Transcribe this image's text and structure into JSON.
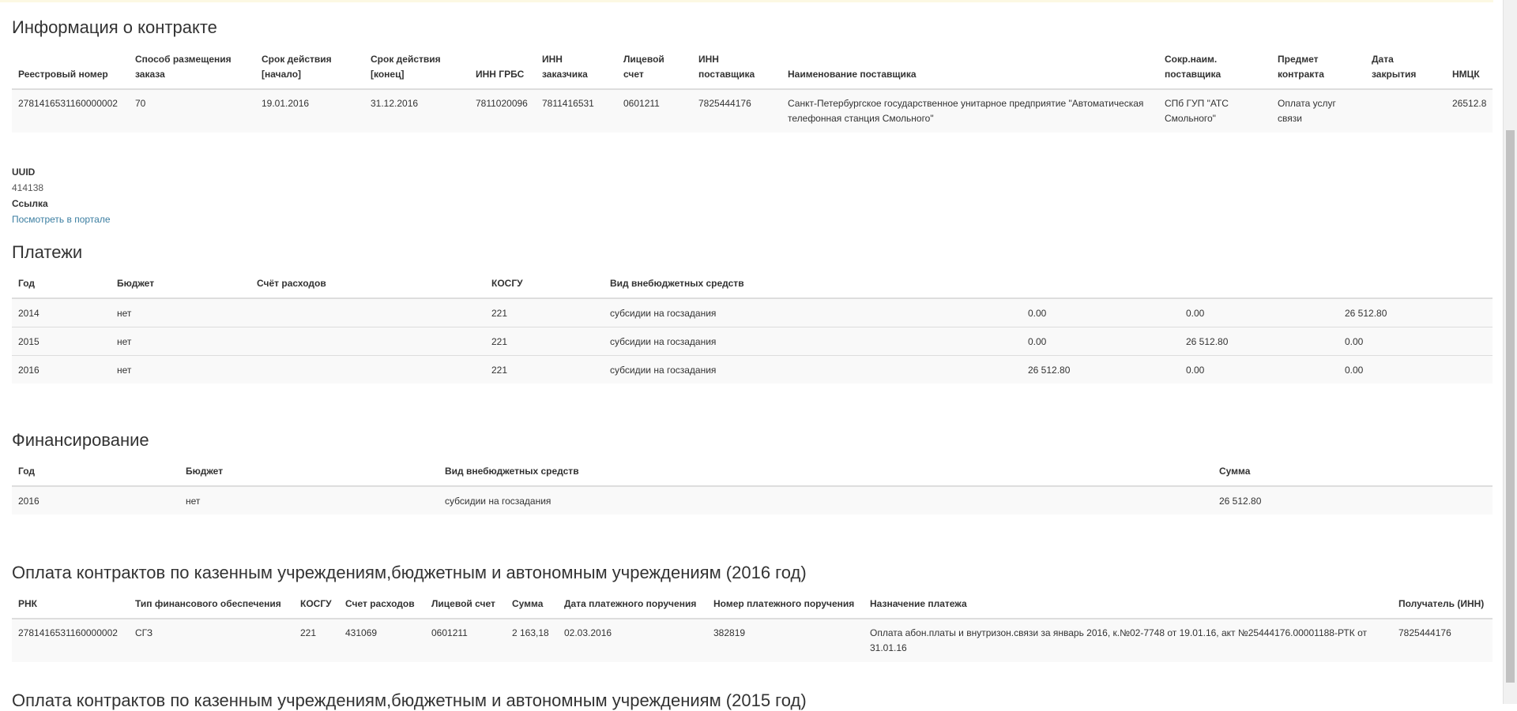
{
  "contract": {
    "title": "Информация о контракте",
    "headers": [
      "Реестровый номер",
      "Способ размещения заказа",
      "Срок действия [начало]",
      "Срок действия [конец]",
      "ИНН ГРБС",
      "ИНН заказчика",
      "Лицевой счет",
      "ИНН поставщика",
      "Наименование поставщика",
      "Сокр.наим. поставщика",
      "Предмет контракта",
      "Дата закрытия",
      "НМЦК"
    ],
    "rows": [
      [
        "2781416531160000002",
        "70",
        "19.01.2016",
        "31.12.2016",
        "7811020096",
        "7811416531",
        "0601211",
        "7825444176",
        "Санкт-Петербургское государственное унитарное предприятие \"Автоматическая телефонная станция Смольного\"",
        "СПб ГУП \"АТС Смольного\"",
        "Оплата услуг связи",
        "",
        "26512.8"
      ]
    ]
  },
  "meta": {
    "uuid_label": "UUID",
    "uuid_value": "414138",
    "link_label": "Ссылка",
    "link_text": "Посмотреть в портале"
  },
  "payments": {
    "title": "Платежи",
    "headers": [
      "Год",
      "Бюджет",
      "Счёт расходов",
      "КОСГУ",
      "Вид внебюджетных средств",
      "",
      "",
      ""
    ],
    "rows": [
      [
        "2014",
        "нет",
        "",
        "221",
        "субсидии на госзадания",
        "0.00",
        "0.00",
        "26 512.80"
      ],
      [
        "2015",
        "нет",
        "",
        "221",
        "субсидии на госзадания",
        "0.00",
        "26 512.80",
        "0.00"
      ],
      [
        "2016",
        "нет",
        "",
        "221",
        "субсидии на госзадания",
        "26 512.80",
        "0.00",
        "0.00"
      ]
    ]
  },
  "financing": {
    "title": "Финансирование",
    "headers": [
      "Год",
      "Бюджет",
      "Вид внебюджетных средств",
      "Сумма"
    ],
    "rows": [
      [
        "2016",
        "нет",
        "субсидии на госзадания",
        "26 512.80"
      ]
    ]
  },
  "contract_payments_2016": {
    "title": "Оплата контрактов по казенным учреждениям,бюджетным и автономным учреждениям (2016 год)",
    "headers": [
      "РНК",
      "Тип финансового обеспечения",
      "КОСГУ",
      "Счет расходов",
      "Лицевой счет",
      "Сумма",
      "Дата платежного поручения",
      "Номер платежного поручения",
      "Назначение платежа",
      "Получатель (ИНН)"
    ],
    "rows": [
      [
        "2781416531160000002",
        "СГЗ",
        "221",
        "431069",
        "0601211",
        "2 163,18",
        "02.03.2016",
        "382819",
        "Оплата абон.платы и внутризон.связи за январь 2016, к.№02-7748 от 19.01.16, акт №25444176.00001188-РТК от 31.01.16",
        "7825444176"
      ]
    ]
  },
  "contract_payments_2015": {
    "title": "Оплата контрактов по казенным учреждениям,бюджетным и автономным учреждениям (2015 год)"
  }
}
